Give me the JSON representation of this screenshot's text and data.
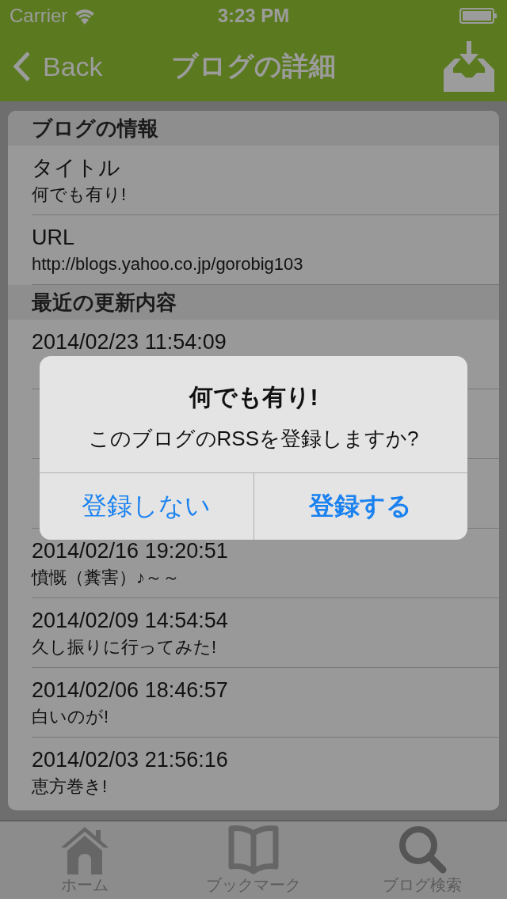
{
  "status_bar": {
    "carrier": "Carrier",
    "time": "3:23 PM"
  },
  "nav_bar": {
    "back": "Back",
    "title": "ブログの詳細"
  },
  "sections": [
    {
      "header": "ブログの情報",
      "rows": [
        {
          "title": "タイトル",
          "subtitle": "何でも有り!"
        },
        {
          "title": "URL",
          "subtitle": "http://blogs.yahoo.co.jp/gorobig103"
        }
      ]
    },
    {
      "header": "最近の更新内容",
      "rows": [
        {
          "title": "2014/02/23 11:54:09"
        },
        {},
        {},
        {
          "title": "2014/02/16 19:20:51",
          "subtitle": "憤慨（糞害）♪～～"
        },
        {
          "title": "2014/02/09 14:54:54",
          "subtitle": "久し振りに行ってみた!"
        },
        {
          "title": "2014/02/06 18:46:57",
          "subtitle": "白いのが!"
        },
        {
          "title": "2014/02/03 21:56:16",
          "subtitle": "恵方巻き!"
        }
      ]
    }
  ],
  "alert": {
    "title": "何でも有り!",
    "message": "このブログのRSSを登録しますか?",
    "buttons": [
      {
        "label": "登録しない",
        "kind": "cancel"
      },
      {
        "label": "登録する",
        "kind": "default"
      }
    ]
  },
  "tab_bar": {
    "items": [
      {
        "label": "ホーム"
      },
      {
        "label": "ブックマーク"
      },
      {
        "label": "ブログ検索"
      }
    ]
  }
}
